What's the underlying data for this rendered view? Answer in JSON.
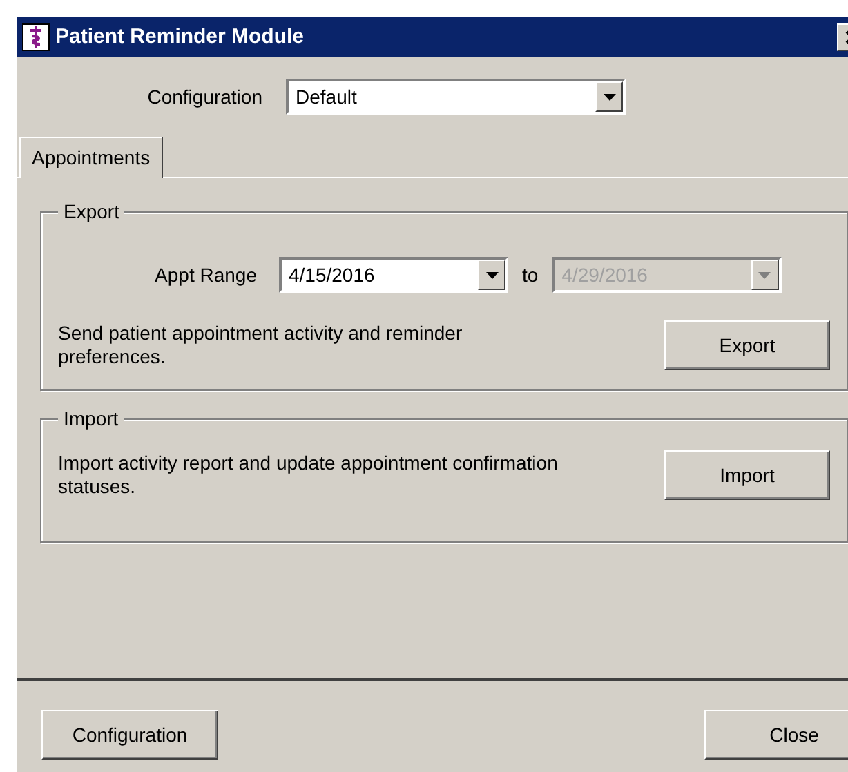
{
  "window": {
    "title": "Patient Reminder Module"
  },
  "configuration": {
    "label": "Configuration",
    "value": "Default"
  },
  "tabs": [
    {
      "label": "Appointments",
      "selected": true
    }
  ],
  "export": {
    "title": "Export",
    "range_label": "Appt Range",
    "from": {
      "value": "4/15/2016",
      "disabled": false
    },
    "to_label": "to",
    "to": {
      "value": "4/29/2016",
      "disabled": true
    },
    "description": "Send patient appointment activity and reminder preferences.",
    "button": "Export"
  },
  "import": {
    "title": "Import",
    "description": "Import activity report and update appointment confirmation statuses.",
    "button": "Import"
  },
  "buttons": [
    {
      "label": "Configuration"
    },
    {
      "label": "Close"
    }
  ]
}
